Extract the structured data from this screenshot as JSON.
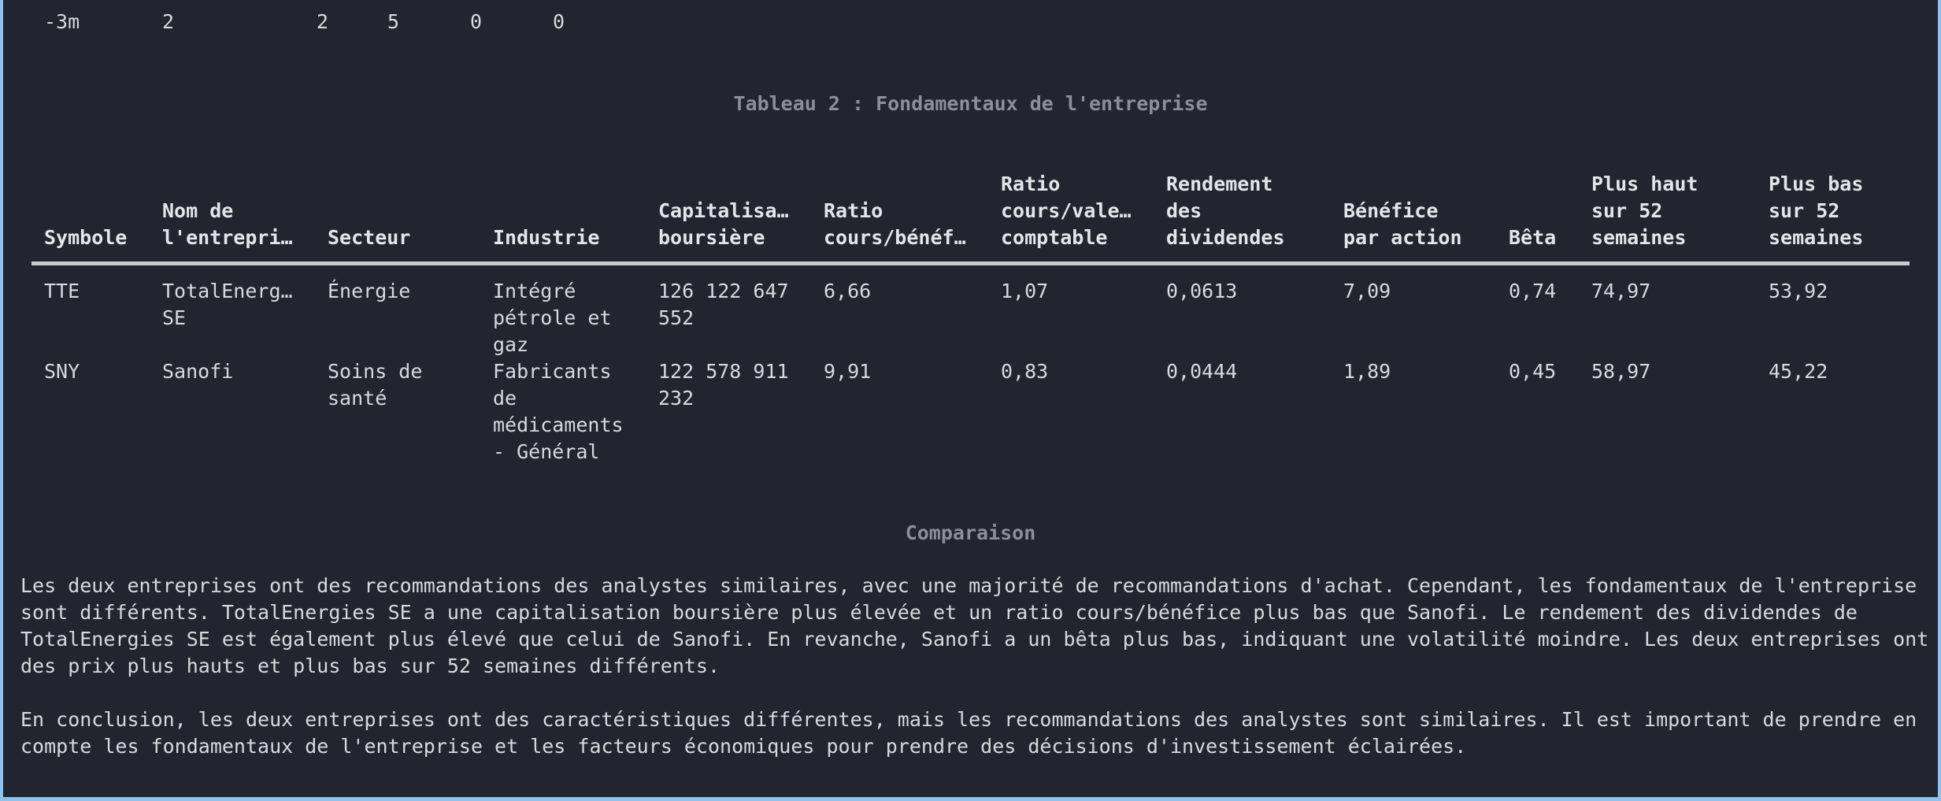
{
  "previous_row": [
    "-3m",
    "2",
    "2",
    "5",
    "0",
    "0"
  ],
  "table2": {
    "caption": "Tableau 2 : Fondamentaux de l'entreprise",
    "headers": [
      "Symbole",
      "Nom de\nl'entrepri…",
      "Secteur",
      "Industrie",
      "Capitalisa…\nboursière",
      "Ratio\ncours/bénéf…",
      "Ratio\ncours/vale…\ncomptable",
      "Rendement\ndes\ndividendes",
      "Bénéfice\npar action",
      "Bêta",
      "Plus haut\nsur 52\nsemaines",
      "Plus bas\nsur 52\nsemaines"
    ],
    "rows": [
      [
        "TTE",
        "TotalEnerg…\nSE",
        "Énergie",
        "Intégré\npétrole et\ngaz",
        "126 122 647\n552",
        "6,66",
        "1,07",
        "0,0613",
        "7,09",
        "0,74",
        "74,97",
        "53,92"
      ],
      [
        "SNY",
        "Sanofi",
        "Soins de\nsanté",
        "Fabricants\nde\nmédicaments\n- Général",
        "122 578 911\n232",
        "9,91",
        "0,83",
        "0,0444",
        "1,89",
        "0,45",
        "58,97",
        "45,22"
      ]
    ]
  },
  "comparison": {
    "heading": "Comparaison",
    "paragraph1": "Les deux entreprises ont des recommandations des analystes similaires, avec une majorité de recommandations d'achat. Cependant, les fondamentaux de l'entreprise\nsont différents. TotalEnergies SE a une capitalisation boursière plus élevée et un ratio cours/bénéfice plus bas que Sanofi. Le rendement des dividendes de\nTotalEnergies SE est également plus élevé que celui de Sanofi. En revanche, Sanofi a un bêta plus bas, indiquant une volatilité moindre. Les deux entreprises ont\ndes prix plus hauts et plus bas sur 52 semaines différents.",
    "paragraph2": "En conclusion, les deux entreprises ont des caractéristiques différentes, mais les recommandations des analystes sont similaires. Il est important de prendre en\ncompte les fondamentaux de l'entreprise et les facteurs économiques pour prendre des décisions d'investissement éclairées."
  }
}
